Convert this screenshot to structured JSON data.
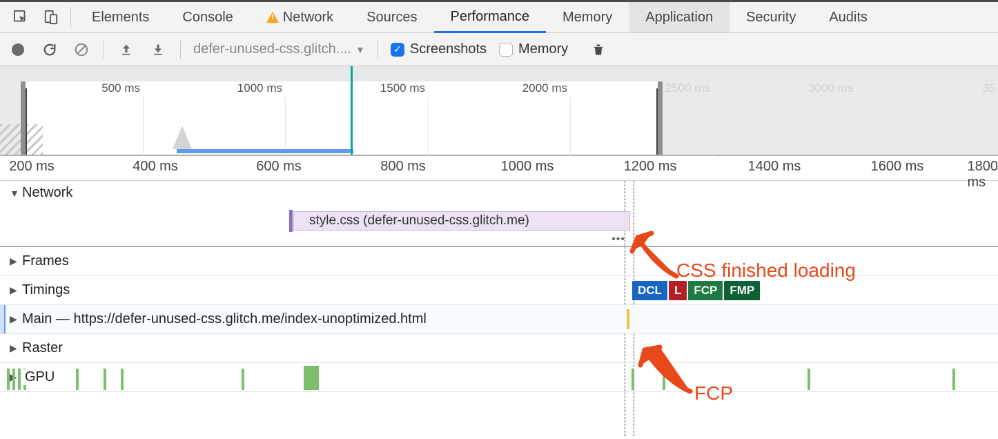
{
  "tabs": {
    "elements": "Elements",
    "console": "Console",
    "network": "Network",
    "sources": "Sources",
    "performance": "Performance",
    "memory": "Memory",
    "application": "Application",
    "security": "Security",
    "audits": "Audits",
    "active": "Performance",
    "highlighted": "Application"
  },
  "toolbar": {
    "url_selector": "defer-unused-css.glitch....",
    "screenshots_label": "Screenshots",
    "screenshots_checked": true,
    "memory_label": "Memory",
    "memory_checked": false
  },
  "overview_ruler": {
    "t1": "500 ms",
    "t2": "1000 ms",
    "t3": "1500 ms",
    "t4": "2000 ms",
    "t5": "2500 ms",
    "t6": "3000 ms",
    "t7": "35"
  },
  "detail_ruler": {
    "d1": "200 ms",
    "d2": "400 ms",
    "d3": "600 ms",
    "d4": "800 ms",
    "d5": "1000 ms",
    "d6": "1200 ms",
    "d7": "1400 ms",
    "d8": "1600 ms",
    "d9": "1800 ms"
  },
  "tracks": {
    "network_label": "Network",
    "frames_label": "Frames",
    "timings_label": "Timings",
    "main_label": "Main — https://defer-unused-css.glitch.me/index-unoptimized.html",
    "raster_label": "Raster",
    "gpu_label": "GPU"
  },
  "network_bar": {
    "label": "style.css (defer-unused-css.glitch.me)"
  },
  "timings": {
    "dcl": "DCL",
    "l": "L",
    "fcp": "FCP",
    "fmp": "FMP"
  },
  "annotations": {
    "css_loaded": "CSS finished loading",
    "fcp": "FCP"
  }
}
